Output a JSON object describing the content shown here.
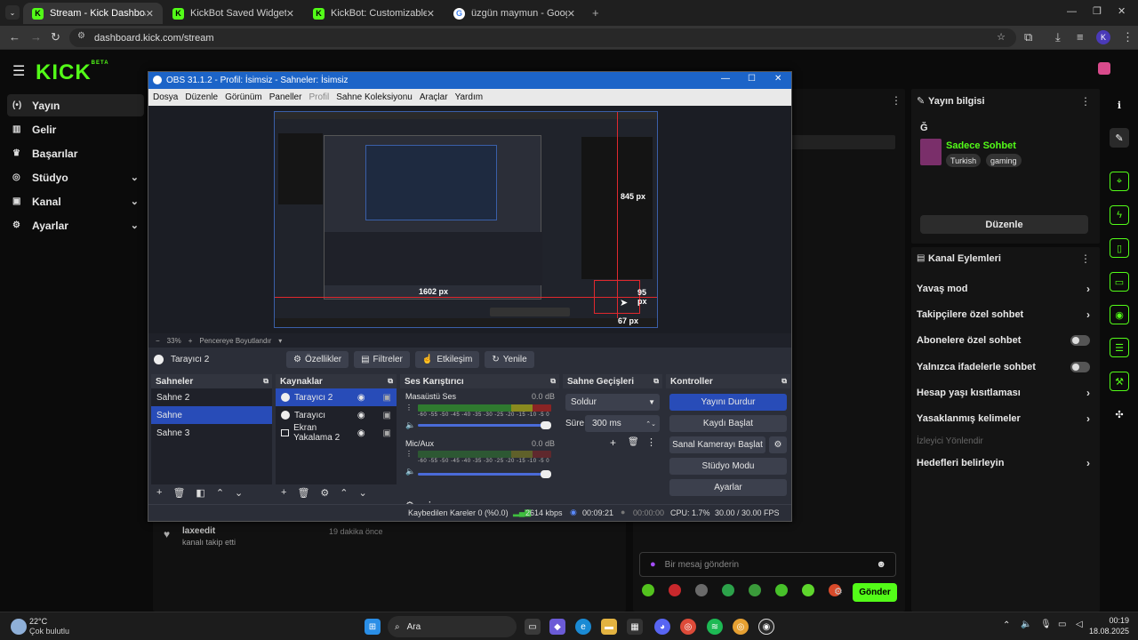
{
  "browser": {
    "tabs": [
      {
        "label": "Stream - Kick Dashboard",
        "icon": "kick-favicon",
        "active": true
      },
      {
        "label": "KickBot Saved Widgets",
        "icon": "kick-favicon"
      },
      {
        "label": "KickBot: Customizable Chat Bo",
        "icon": "kick-favicon"
      },
      {
        "label": "üzgün maymun - Google'da Ar",
        "icon": "google-favicon"
      }
    ],
    "url": "dashboard.kick.com/stream",
    "profile_initial": "K"
  },
  "kick": {
    "logo": "KICK",
    "logo_tag": "BETA",
    "nav": [
      {
        "label": "Yayın",
        "icon": "broadcast-icon",
        "active": true
      },
      {
        "label": "Gelir",
        "icon": "revenue-icon"
      },
      {
        "label": "Başarılar",
        "icon": "trophy-icon"
      },
      {
        "label": "Stüdyo",
        "icon": "studio-icon",
        "expand": true
      },
      {
        "label": "Kanal",
        "icon": "channel-icon",
        "expand": true
      },
      {
        "label": "Ayarlar",
        "icon": "settings-icon",
        "expand": true
      }
    ],
    "activity": {
      "user": "laxeedit",
      "action": "kanalı takip etti",
      "time": "19 dakika önce"
    },
    "stream_info": {
      "title": "Yayın bilgisi",
      "initial": "Ğ",
      "category": "Sadece Sohbet",
      "tags": [
        "Turkish",
        "gaming"
      ],
      "edit_label": "Düzenle"
    },
    "channel_actions": {
      "title": "Kanal Eylemleri",
      "items": [
        {
          "label": "Yavaş mod",
          "control": "chevron"
        },
        {
          "label": "Takipçilere özel sohbet",
          "control": "chevron"
        },
        {
          "label": "Abonelere özel sohbet",
          "control": "toggle"
        },
        {
          "label": "Yalnızca ifadelerle sohbet",
          "control": "toggle"
        },
        {
          "label": "Hesap yaşı kısıtlaması",
          "control": "chevron"
        },
        {
          "label": "Yasaklanmış kelimeler",
          "control": "chevron"
        },
        {
          "label": "İzleyici Yönlendir",
          "control": "none",
          "disabled": true
        },
        {
          "label": "Hedefleri belirleyin",
          "control": "chevron"
        }
      ]
    },
    "chat": {
      "placeholder": "Bir mesaj gönderin",
      "send_label": "Gönder"
    }
  },
  "obs": {
    "title": "OBS 31.1.2 - Profil: İsimsiz - Sahneler: İsimsiz",
    "menu": [
      "Dosya",
      "Düzenle",
      "Görünüm",
      "Paneller",
      "Profil",
      "Sahne Koleksiyonu",
      "Araçlar",
      "Yardım"
    ],
    "preview_labels": {
      "w1": "1602 px",
      "w2": "845 px",
      "w3": "95 px",
      "w4": "67 px"
    },
    "zoom": {
      "value": "33%",
      "fit_label": "Pencereye Boyutlandır"
    },
    "source_bar": {
      "selected_source": "Tarayıcı 2",
      "buttons": [
        "Özellikler",
        "Filtreler",
        "Etkileşim",
        "Yenile"
      ]
    },
    "scenes": {
      "title": "Sahneler",
      "items": [
        "Sahne 2",
        "Sahne",
        "Sahne 3"
      ],
      "selected": 1
    },
    "sources": {
      "title": "Kaynaklar",
      "items": [
        "Tarayıcı 2",
        "Tarayıcı",
        "Ekran Yakalama 2"
      ],
      "selected": 0
    },
    "mixer": {
      "title": "Ses Karıştırıcı",
      "tracks": [
        {
          "name": "Masaüstü Ses",
          "db": "0.0 dB"
        },
        {
          "name": "Mic/Aux",
          "db": "0.0 dB"
        }
      ],
      "scale": "-60 -55 -50 -45 -40 -35 -30 -25 -20 -15 -10 -5 0"
    },
    "transitions": {
      "title": "Sahne Geçişleri",
      "type": "Soldur",
      "duration_label": "Süre",
      "duration": "300 ms"
    },
    "controls": {
      "title": "Kontroller",
      "buttons": [
        "Yayını Durdur",
        "Kaydı Başlat",
        "Sanal Kamerayı Başlat",
        "Stüdyo Modu",
        "Ayarlar"
      ]
    },
    "status": {
      "dropped": "Kaybedilen Kareler 0 (%0.0)",
      "bitrate": "2614 kbps",
      "stream_time": "00:09:21",
      "rec_time": "00:00:00",
      "cpu": "CPU: 1.7%",
      "fps": "30.00 / 30.00 FPS"
    },
    "accent": "#284cb8"
  },
  "taskbar": {
    "weather_temp": "22°C",
    "weather_desc": "Çok bulutlu",
    "search": "Ara",
    "time": "00:19",
    "date": "18.08.2025"
  }
}
